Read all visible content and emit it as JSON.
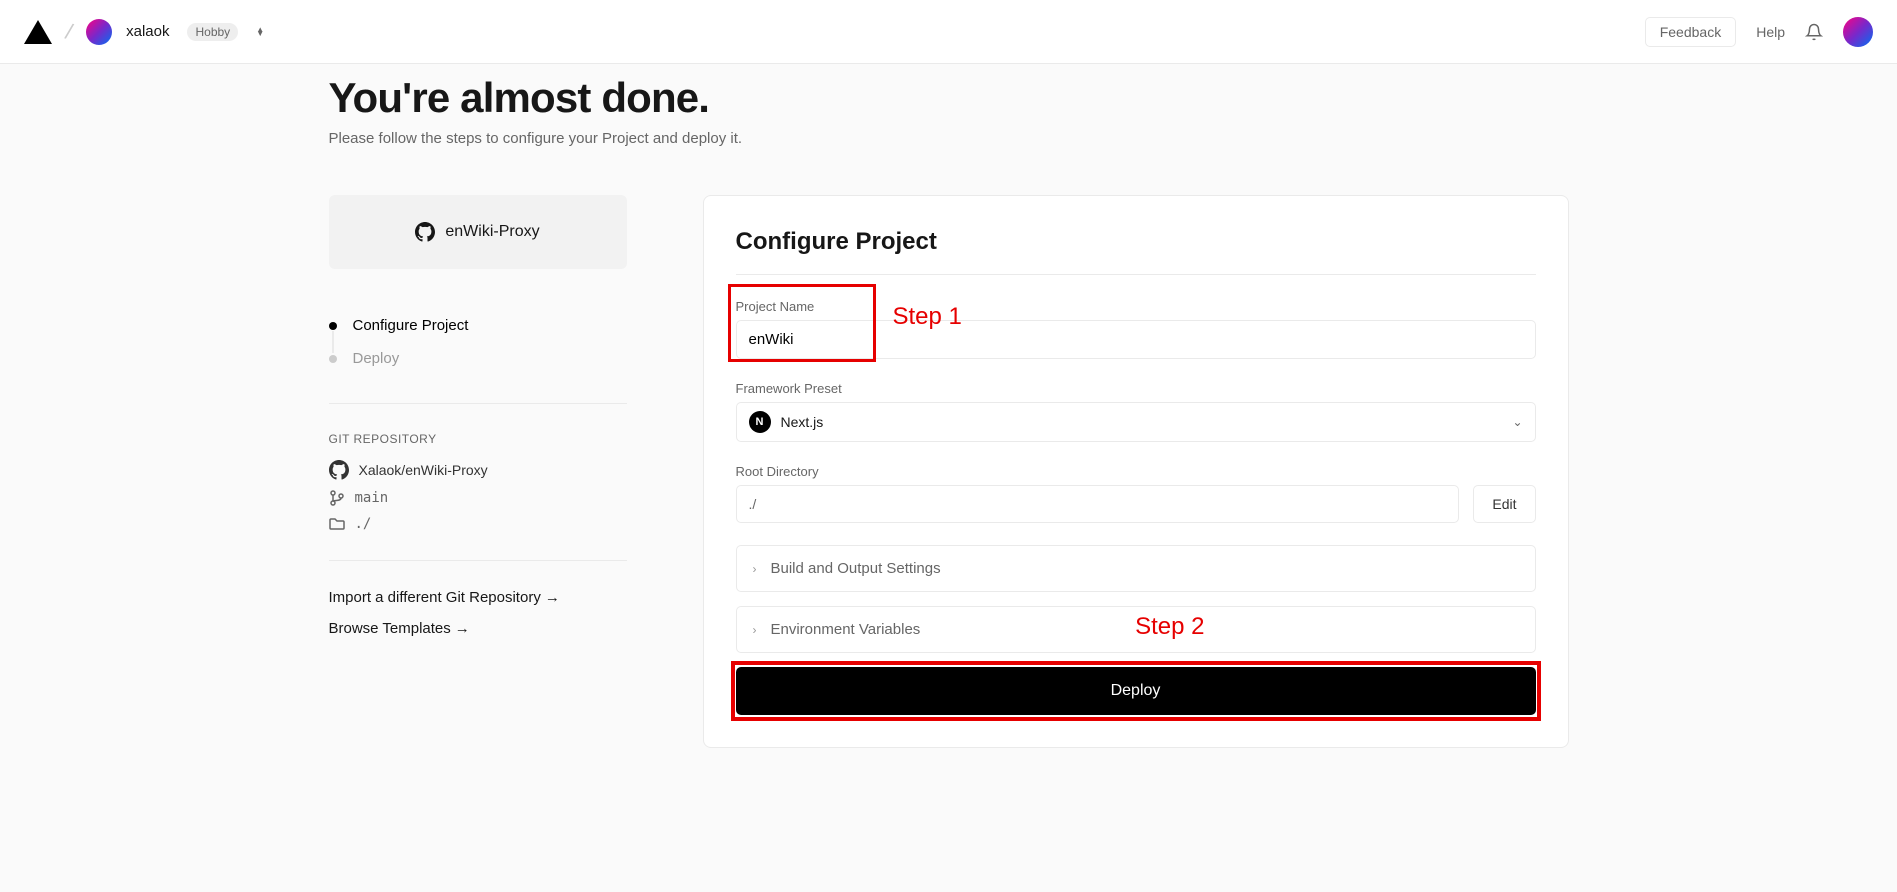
{
  "header": {
    "team_name": "xalaok",
    "plan": "Hobby",
    "feedback": "Feedback",
    "help": "Help"
  },
  "page": {
    "title": "You're almost done.",
    "subtitle": "Please follow the steps to configure your Project and deploy it."
  },
  "sidebar": {
    "repo_display": "enWiki-Proxy",
    "steps": [
      {
        "label": "Configure Project",
        "active": true
      },
      {
        "label": "Deploy",
        "active": false
      }
    ],
    "git_heading": "GIT REPOSITORY",
    "git_repo": "Xalaok/enWiki-Proxy",
    "git_branch": "main",
    "git_dir": "./",
    "action_import": "Import a different Git Repository",
    "action_browse": "Browse Templates"
  },
  "form": {
    "card_title": "Configure Project",
    "project_name_label": "Project Name",
    "project_name_value": "enWiki",
    "framework_label": "Framework Preset",
    "framework_value": "Next.js",
    "root_label": "Root Directory",
    "root_value": "./",
    "edit": "Edit",
    "accordion_build": "Build and Output Settings",
    "accordion_env": "Environment Variables",
    "deploy": "Deploy"
  },
  "annotations": {
    "step1": "Step 1",
    "step2": "Step 2"
  }
}
